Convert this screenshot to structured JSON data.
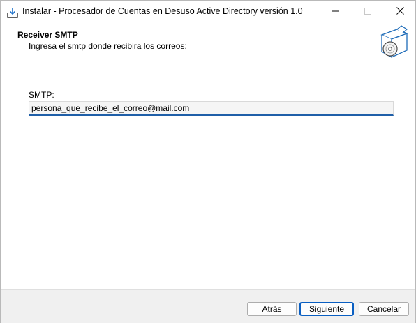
{
  "window": {
    "title": "Instalar - Procesador de Cuentas en Desuso Active Directory versión 1.0",
    "icons": [
      "install-icon",
      "minimize-icon",
      "maximize-icon",
      "close-icon",
      "setup-box-icon"
    ]
  },
  "header": {
    "title": "Receiver SMTP",
    "subtitle": "Ingresa el smtp donde recibira los correos:"
  },
  "form": {
    "smtp_label": "SMTP:",
    "smtp_value": "persona_que_recibe_el_correo@mail.com"
  },
  "footer": {
    "back_label": "Atrás",
    "next_label": "Siguiente",
    "cancel_label": "Cancelar"
  },
  "colors": {
    "accent": "#0a5fc2",
    "footer_bg": "#f0f0f0"
  }
}
